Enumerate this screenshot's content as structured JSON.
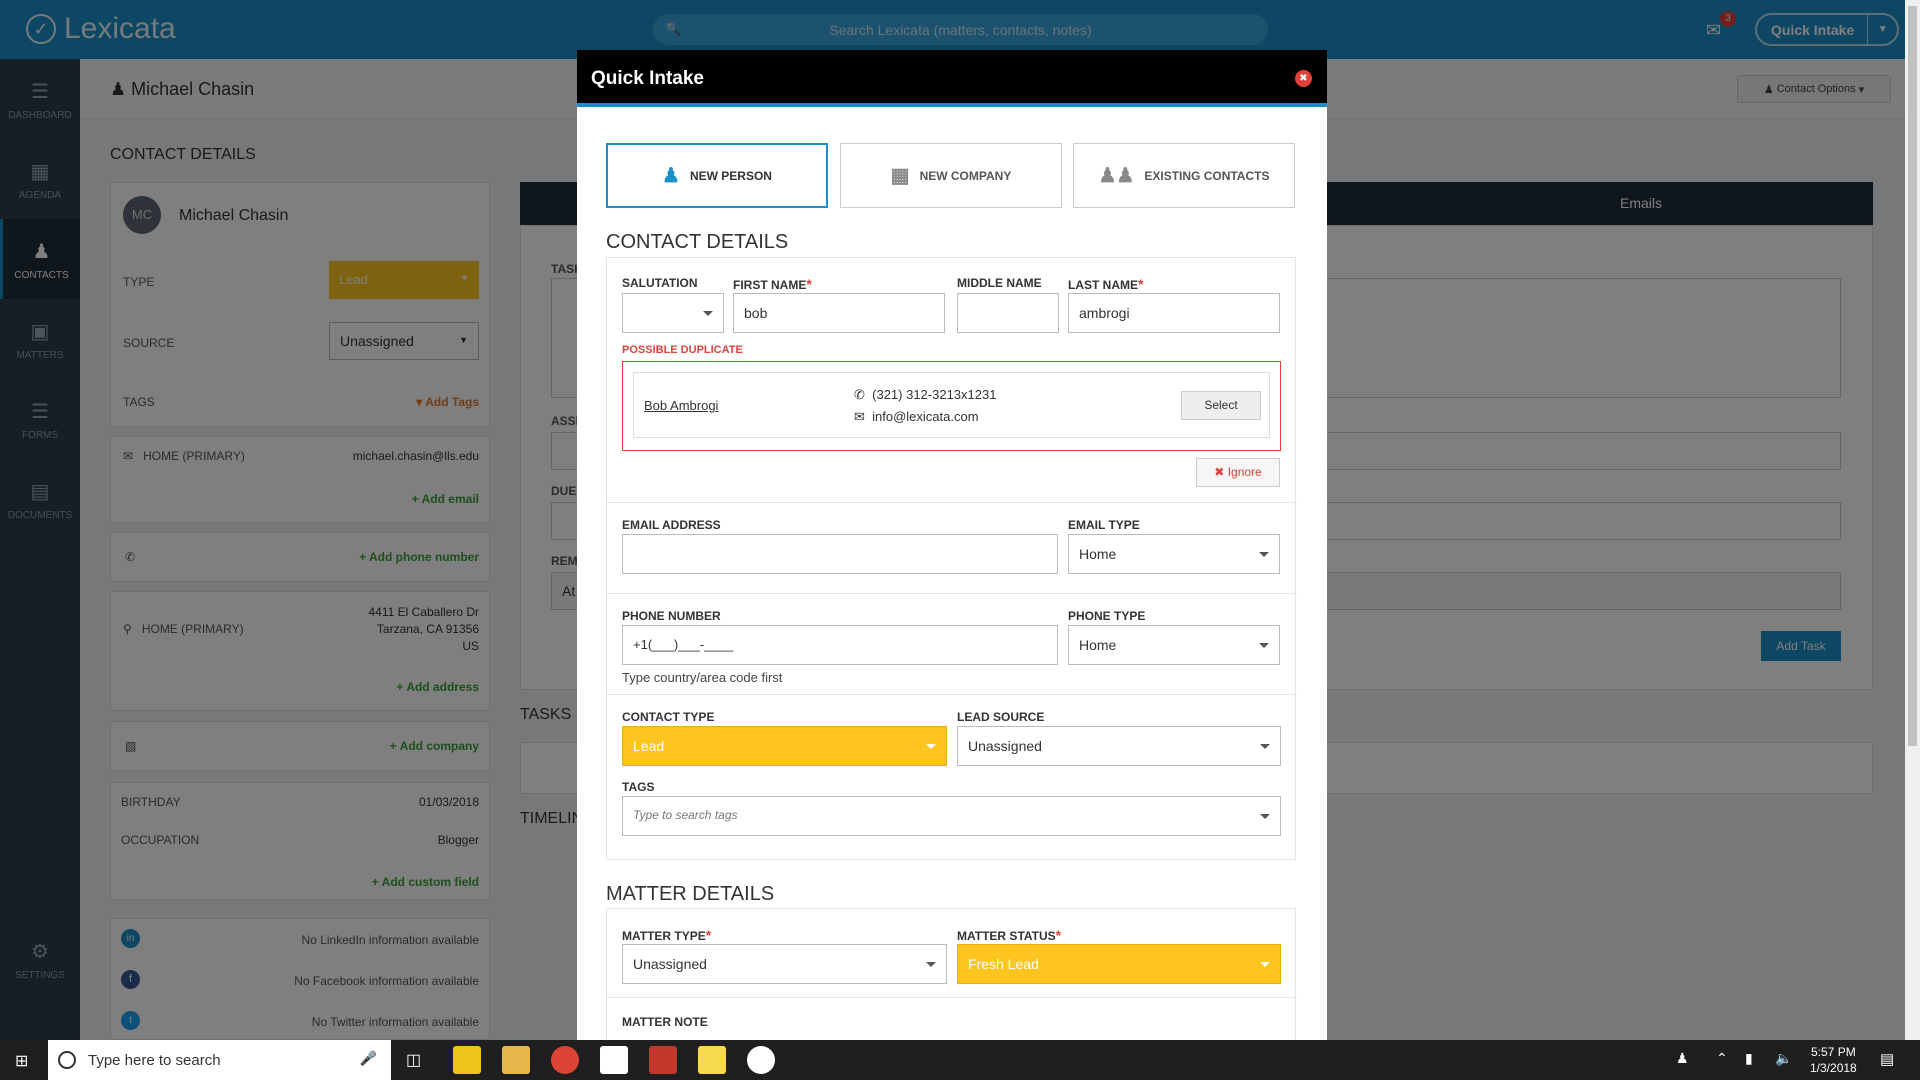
{
  "app": {
    "logo": "Lexicata",
    "search_placeholder": "Search Lexicata (matters, contacts, notes)",
    "inbox_count": "3",
    "quick_intake": "Quick Intake"
  },
  "sidebar": [
    {
      "label": "DASHBOARD",
      "icon": "dashboard-icon"
    },
    {
      "label": "AGENDA",
      "icon": "calendar-icon"
    },
    {
      "label": "CONTACTS",
      "icon": "person-icon",
      "active": true
    },
    {
      "label": "MATTERS",
      "icon": "archive-icon"
    },
    {
      "label": "FORMS",
      "icon": "list-icon"
    },
    {
      "label": "DOCUMENTS",
      "icon": "file-icon"
    },
    {
      "label": "SETTINGS",
      "icon": "gear-icon"
    }
  ],
  "page": {
    "contact_name": "Michael Chasin",
    "contact_options": "Contact Options"
  },
  "left": {
    "section_title": "CONTACT DETAILS",
    "initials": "MC",
    "name": "Michael Chasin",
    "type_label": "TYPE",
    "type_value": "Lead",
    "source_label": "SOURCE",
    "source_value": "Unassigned",
    "tags_label": "TAGS",
    "add_tags": "Add Tags",
    "email_label": "HOME (PRIMARY)",
    "email_value": "michael.chasin@lls.edu",
    "add_email": "Add email",
    "add_phone": "Add phone number",
    "address_label": "HOME (PRIMARY)",
    "address_lines": [
      "4411 El Caballero Dr",
      "Tarzana, CA 91356",
      "US"
    ],
    "add_address": "Add address",
    "add_company": "Add company",
    "birthday_label": "BIRTHDAY",
    "birthday_value": "01/03/2018",
    "occupation_label": "OCCUPATION",
    "occupation_value": "Blogger",
    "add_custom_field": "Add custom field",
    "linkedin": "No LinkedIn information available",
    "facebook": "No Facebook information available",
    "twitter": "No Twitter information available"
  },
  "right": {
    "emails_tab": "Emails",
    "add_task": "Add Task",
    "tasks_title": "TASKS",
    "timeline_title": "TIMELIN",
    "task_labels": [
      "TASK",
      "ASSI",
      "DUE",
      "REM"
    ],
    "reminder_value": "At"
  },
  "modal": {
    "title": "Quick Intake",
    "tabs": [
      "NEW PERSON",
      "NEW COMPANY",
      "EXISTING CONTACTS"
    ],
    "contact_details_title": "CONTACT DETAILS",
    "salutation_label": "SALUTATION",
    "salutation_value": "",
    "first_name_label": "FIRST NAME",
    "first_name_value": "bob",
    "middle_name_label": "MIDDLE NAME",
    "middle_name_value": "",
    "last_name_label": "LAST NAME",
    "last_name_value": "ambrogi",
    "duplicate_label": "POSSIBLE DUPLICATE",
    "duplicate": {
      "name": "Bob Ambrogi",
      "phone": "(321) 312-3213x1231",
      "email": "info@lexicata.com",
      "select": "Select"
    },
    "ignore": "Ignore",
    "email_label": "EMAIL ADDRESS",
    "email_value": "",
    "email_type_label": "EMAIL TYPE",
    "email_type_value": "Home",
    "phone_label": "PHONE NUMBER",
    "phone_value": "+1(___)___-____",
    "phone_type_label": "PHONE TYPE",
    "phone_type_value": "Home",
    "phone_hint": "Type country/area code first",
    "contact_type_label": "CONTACT TYPE",
    "contact_type_value": "Lead",
    "lead_source_label": "LEAD SOURCE",
    "lead_source_value": "Unassigned",
    "tags_label": "TAGS",
    "tags_placeholder": "Type to search tags",
    "matter_details_title": "MATTER DETAILS",
    "matter_type_label": "MATTER TYPE",
    "matter_type_value": "Unassigned",
    "matter_status_label": "MATTER STATUS",
    "matter_status_value": "Fresh Lead",
    "matter_note_label": "MATTER NOTE"
  },
  "taskbar": {
    "search": "Type here to search",
    "time": "5:57 PM",
    "date": "1/3/2018"
  },
  "colors": {
    "brand": "#1c8fc9",
    "lead_yellow": "#fdc51e",
    "danger": "#e0413a"
  }
}
